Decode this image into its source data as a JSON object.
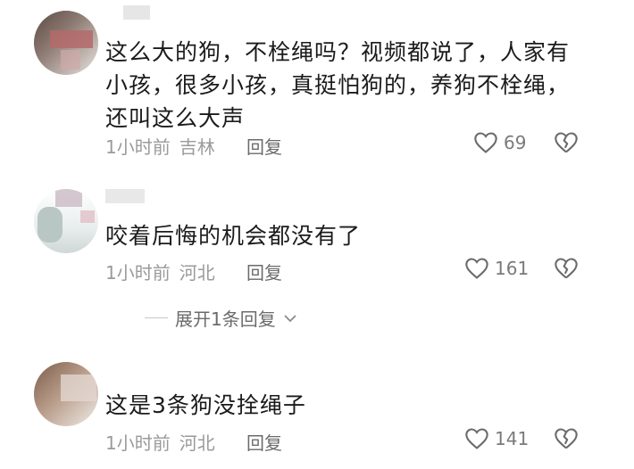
{
  "comments": [
    {
      "text": "这么大的狗，不栓绳吗？视频都说了，人家有小孩，很多小孩，真挺怕狗的，养狗不栓绳，还叫这么大声",
      "time": "1小时前",
      "location": "吉林",
      "reply_label": "回复",
      "likes": "69"
    },
    {
      "text": "咬着后悔的机会都没有了",
      "time": "1小时前",
      "location": "河北",
      "reply_label": "回复",
      "likes": "161",
      "expand_label": "展开1条回复"
    },
    {
      "text": "这是3条狗没拴绳子",
      "time": "1小时前",
      "location": "河北",
      "reply_label": "回复",
      "likes": "141"
    }
  ],
  "icons": {
    "like": "heart-outline-icon",
    "dislike": "broken-heart-icon",
    "expand": "chevron-down-icon"
  },
  "colors": {
    "meta_text": "#9a9a9a",
    "icon": "#6b6b6b"
  }
}
